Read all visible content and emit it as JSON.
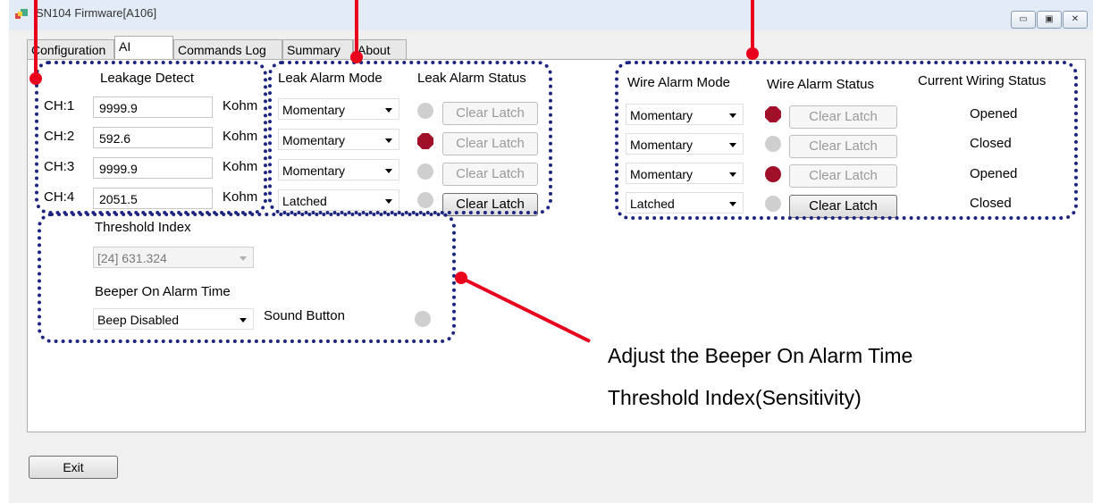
{
  "window": {
    "title": "SN104 Firmware[A106]",
    "icon": "app-icon"
  },
  "window_buttons": {
    "minimize": "▭",
    "maximize": "▣",
    "close": "✕"
  },
  "tabs": [
    {
      "label": "Configuration"
    },
    {
      "label": "AI"
    },
    {
      "label": "Commands Log"
    },
    {
      "label": "Summary"
    },
    {
      "label": "About"
    }
  ],
  "leakage": {
    "title": "Leakage Detect",
    "unit": "Kohm",
    "channels": [
      {
        "label": "CH:1",
        "value": "9999.9"
      },
      {
        "label": "CH:2",
        "value": "592.6"
      },
      {
        "label": "CH:3",
        "value": "9999.9"
      },
      {
        "label": "CH:4",
        "value": "2051.5"
      }
    ]
  },
  "leak_alarm": {
    "mode_title": "Leak Alarm Mode",
    "status_title": "Leak Alarm Status",
    "rows": [
      {
        "mode": "Momentary",
        "led": "off",
        "button": "Clear Latch",
        "enabled": false
      },
      {
        "mode": "Momentary",
        "led": "on",
        "button": "Clear Latch",
        "enabled": false
      },
      {
        "mode": "Momentary",
        "led": "off",
        "button": "Clear Latch",
        "enabled": false
      },
      {
        "mode": "Latched",
        "led": "off",
        "button": "Clear Latch",
        "enabled": true
      }
    ]
  },
  "wire_alarm": {
    "mode_title": "Wire Alarm Mode",
    "status_title": "Wire Alarm Status",
    "wiring_title": "Current Wiring  Status",
    "rows": [
      {
        "mode": "Momentary",
        "led": "on",
        "button": "Clear Latch",
        "enabled": false,
        "wiring": "Opened"
      },
      {
        "mode": "Momentary",
        "led": "off",
        "button": "Clear Latch",
        "enabled": false,
        "wiring": "Closed"
      },
      {
        "mode": "Momentary",
        "led": "on",
        "button": "Clear Latch",
        "enabled": false,
        "wiring": "Opened"
      },
      {
        "mode": "Latched",
        "led": "off",
        "button": "Clear Latch",
        "enabled": true,
        "wiring": "Closed"
      }
    ]
  },
  "threshold": {
    "label": "Threshold Index",
    "value": "[24] 631.324"
  },
  "beeper": {
    "label": "Beeper On Alarm Time",
    "value": "Beep Disabled",
    "sound_label": "Sound Button"
  },
  "annotation": {
    "line1": "Adjust the Beeper On Alarm Time",
    "line2": "Threshold Index(Sensitivity)"
  },
  "footer": {
    "exit_label": "Exit"
  },
  "colors": {
    "led_on": "#a01028",
    "led_off": "#cfcfcf",
    "callout_red": "#e8001c",
    "dotted_border": "#1c2580"
  }
}
